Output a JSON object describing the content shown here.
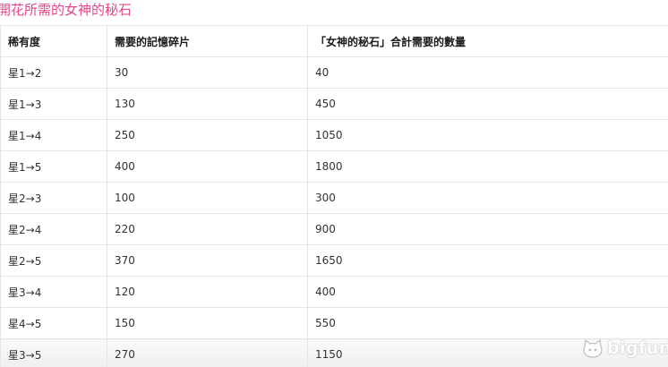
{
  "section": {
    "title": "開花所需的女神的秘石"
  },
  "table": {
    "headers": [
      "稀有度",
      "需要的記憶碎片",
      "「女神的秘石」合計需要的數量"
    ],
    "rows": [
      [
        "星1→2",
        "30",
        "40"
      ],
      [
        "星1→3",
        "130",
        "450"
      ],
      [
        "星1→4",
        "250",
        "1050"
      ],
      [
        "星1→5",
        "400",
        "1800"
      ],
      [
        "星2→3",
        "100",
        "300"
      ],
      [
        "星2→4",
        "220",
        "900"
      ],
      [
        "星2→5",
        "370",
        "1650"
      ],
      [
        "星3→4",
        "120",
        "400"
      ],
      [
        "星4→5",
        "150",
        "550"
      ],
      [
        "星3→5",
        "270",
        "1150"
      ]
    ]
  },
  "watermark": {
    "text": "bigfun",
    "icon": "bigfun-cat-logo-icon"
  },
  "colors": {
    "title": "#e8468c",
    "border": "#e6e6e6"
  }
}
